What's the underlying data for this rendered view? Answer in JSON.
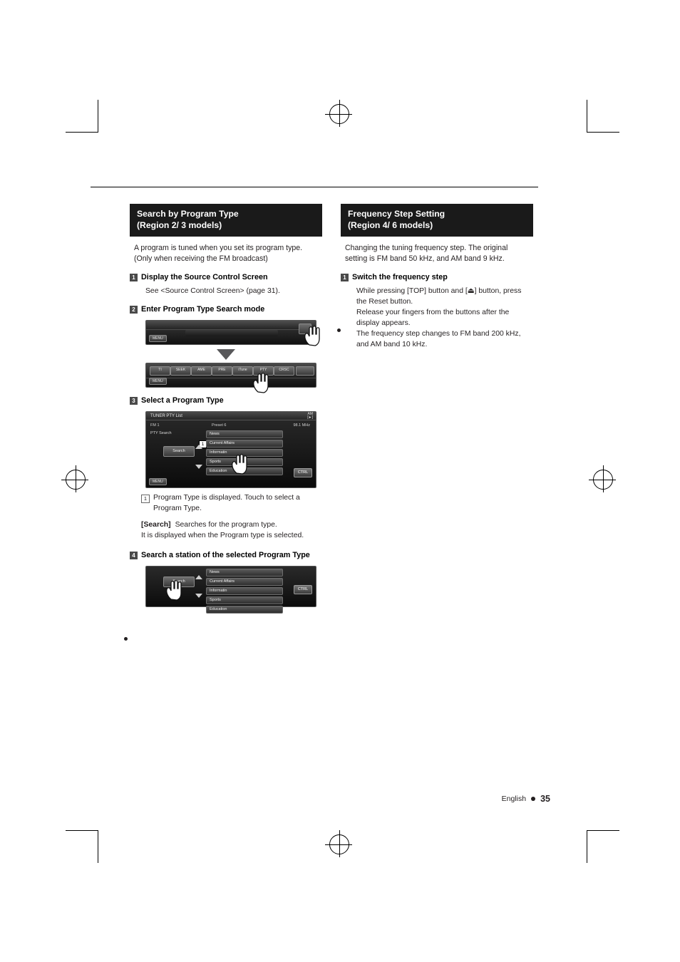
{
  "page": {
    "language": "English",
    "number": "35"
  },
  "left_column": {
    "heading_line1": "Search by Program Type",
    "heading_line2": "(Region 2/ 3 models)",
    "intro": "A program is tuned when you set its program type. (Only when receiving the FM broadcast)",
    "steps": [
      {
        "num": "1",
        "title": "Display the Source Control Screen",
        "body": "See <Source Control Screen> (page 31)."
      },
      {
        "num": "2",
        "title": "Enter Program Type Search mode"
      },
      {
        "num": "3",
        "title": "Select a Program Type"
      },
      {
        "num": "4",
        "title": "Search a station of the selected Program Type"
      }
    ],
    "step3_notes": {
      "callout_num": "1",
      "callout_text": "Program Type is displayed. Touch to select a Program Type.",
      "search_label": "[Search]",
      "search_text": "Searches for the program type.",
      "search_text2": "It is displayed when the Program type is selected."
    }
  },
  "right_column": {
    "heading_line1": "Frequency Step Setting",
    "heading_line2": "(Region 4/ 6 models)",
    "intro": "Changing the tuning frequency step. The original setting is FM band 50 kHz, and AM band 9 kHz.",
    "step": {
      "num": "1",
      "title": "Switch the frequency step",
      "line1": "While pressing [TOP] button and [⏏] button, press the Reset button.",
      "line2": "Release your fingers from the buttons after the display appears.",
      "line3": "The frequency step changes to FM band 200 kHz, and AM band 10 kHz."
    }
  },
  "illustrations": {
    "source_control": {
      "menu_tab": "MENU"
    },
    "function_bar": {
      "menu_tab": "MENU",
      "buttons": [
        "TI",
        "SEEK",
        "AME",
        "PRE",
        "iTune",
        "PTY",
        "CRSC"
      ]
    },
    "pty_screen": {
      "title": "TUNER PTY List",
      "band": "FM 1",
      "preset": "Preset 6",
      "frequency": "98.1 MHz",
      "band_icon_1": "AM",
      "band_icon_2": "[►]",
      "sub_label": "PTY Search",
      "search_button": "Search",
      "ctrl_button": "CTRL",
      "menu_tab": "MENU",
      "callout": "1",
      "list": [
        "News",
        "Current Affairs",
        "Informatin",
        "Sports",
        "Education"
      ]
    },
    "pty_list_screen": {
      "search_button": "Search",
      "ctrl_button": "CTRL",
      "list": [
        "News",
        "Current Affairs",
        "Informatin",
        "Sports",
        "Education"
      ]
    }
  }
}
